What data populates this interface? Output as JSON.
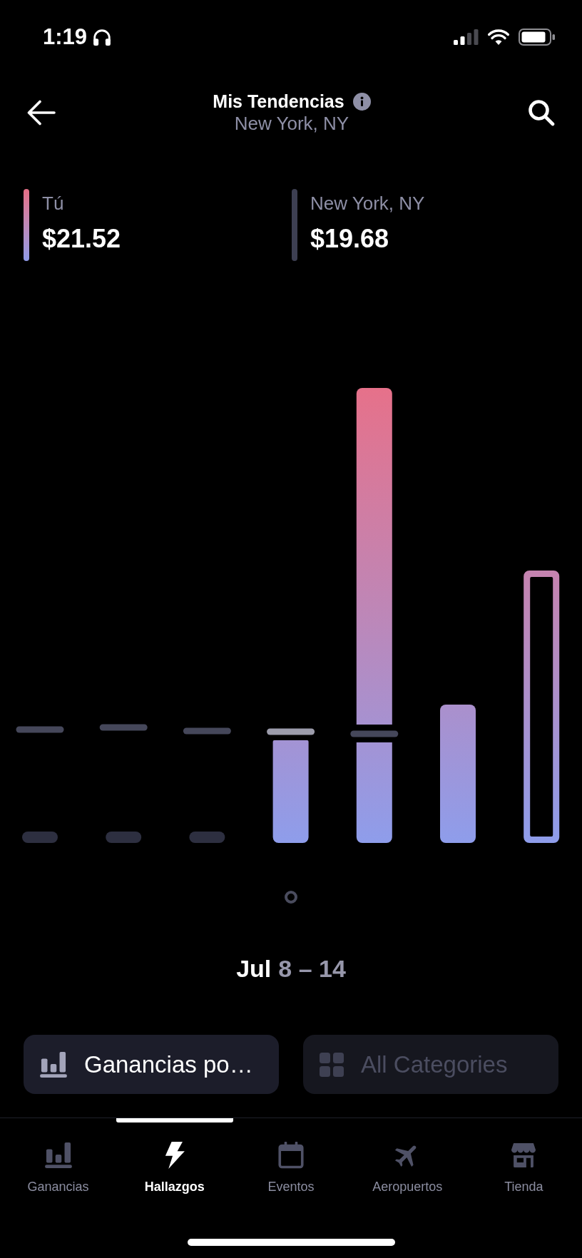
{
  "status_bar": {
    "time": "1:19"
  },
  "header": {
    "title": "Mis Tendencias",
    "subtitle": "New York, NY"
  },
  "stats": [
    {
      "label": "Tú",
      "value": "$21.52",
      "kind": "gradient"
    },
    {
      "label": "New York, NY",
      "value": "$19.68",
      "kind": "plain"
    }
  ],
  "chart": {
    "days": [
      {
        "kind": "empty",
        "average_marker": {
          "highlighted": false
        }
      },
      {
        "kind": "empty",
        "average_marker": {
          "highlighted": false
        }
      },
      {
        "kind": "empty",
        "average_marker": {
          "highlighted": false
        }
      },
      {
        "kind": "filled",
        "average_marker": {
          "highlighted": true
        }
      },
      {
        "kind": "filled",
        "average_marker": {
          "highlighted": false
        }
      },
      {
        "kind": "filled"
      },
      {
        "kind": "outline"
      }
    ]
  },
  "week": {
    "month": "Jul",
    "range": "8 – 14"
  },
  "filters": [
    {
      "label": "Ganancias po…",
      "kind": "metric",
      "disabled": false
    },
    {
      "label": "All Categories",
      "kind": "category",
      "disabled": true
    }
  ],
  "tabs": [
    {
      "label": "Ganancias",
      "selected": false
    },
    {
      "label": "Hallazgos",
      "selected": true
    },
    {
      "label": "Eventos",
      "selected": false
    },
    {
      "label": "Aeropuertos",
      "selected": false
    },
    {
      "label": "Tienda",
      "selected": false
    }
  ]
}
